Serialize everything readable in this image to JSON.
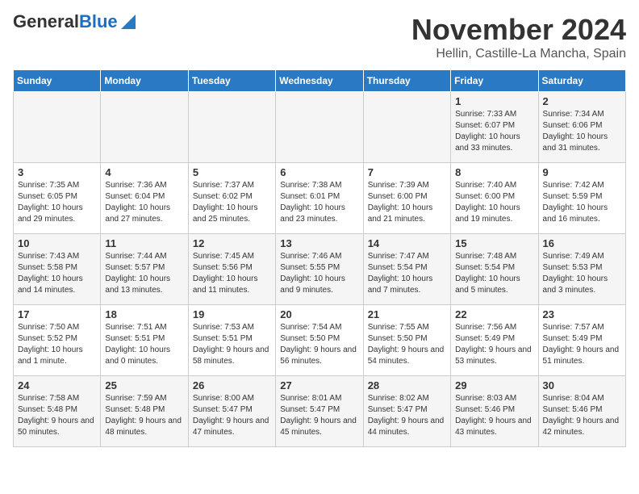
{
  "header": {
    "logo_line1": "General",
    "logo_line2": "Blue",
    "title": "November 2024",
    "subtitle": "Hellin, Castille-La Mancha, Spain"
  },
  "calendar": {
    "days_of_week": [
      "Sunday",
      "Monday",
      "Tuesday",
      "Wednesday",
      "Thursday",
      "Friday",
      "Saturday"
    ],
    "weeks": [
      [
        {
          "day": "",
          "info": ""
        },
        {
          "day": "",
          "info": ""
        },
        {
          "day": "",
          "info": ""
        },
        {
          "day": "",
          "info": ""
        },
        {
          "day": "",
          "info": ""
        },
        {
          "day": "1",
          "info": "Sunrise: 7:33 AM\nSunset: 6:07 PM\nDaylight: 10 hours and 33 minutes."
        },
        {
          "day": "2",
          "info": "Sunrise: 7:34 AM\nSunset: 6:06 PM\nDaylight: 10 hours and 31 minutes."
        }
      ],
      [
        {
          "day": "3",
          "info": "Sunrise: 7:35 AM\nSunset: 6:05 PM\nDaylight: 10 hours and 29 minutes."
        },
        {
          "day": "4",
          "info": "Sunrise: 7:36 AM\nSunset: 6:04 PM\nDaylight: 10 hours and 27 minutes."
        },
        {
          "day": "5",
          "info": "Sunrise: 7:37 AM\nSunset: 6:02 PM\nDaylight: 10 hours and 25 minutes."
        },
        {
          "day": "6",
          "info": "Sunrise: 7:38 AM\nSunset: 6:01 PM\nDaylight: 10 hours and 23 minutes."
        },
        {
          "day": "7",
          "info": "Sunrise: 7:39 AM\nSunset: 6:00 PM\nDaylight: 10 hours and 21 minutes."
        },
        {
          "day": "8",
          "info": "Sunrise: 7:40 AM\nSunset: 6:00 PM\nDaylight: 10 hours and 19 minutes."
        },
        {
          "day": "9",
          "info": "Sunrise: 7:42 AM\nSunset: 5:59 PM\nDaylight: 10 hours and 16 minutes."
        }
      ],
      [
        {
          "day": "10",
          "info": "Sunrise: 7:43 AM\nSunset: 5:58 PM\nDaylight: 10 hours and 14 minutes."
        },
        {
          "day": "11",
          "info": "Sunrise: 7:44 AM\nSunset: 5:57 PM\nDaylight: 10 hours and 13 minutes."
        },
        {
          "day": "12",
          "info": "Sunrise: 7:45 AM\nSunset: 5:56 PM\nDaylight: 10 hours and 11 minutes."
        },
        {
          "day": "13",
          "info": "Sunrise: 7:46 AM\nSunset: 5:55 PM\nDaylight: 10 hours and 9 minutes."
        },
        {
          "day": "14",
          "info": "Sunrise: 7:47 AM\nSunset: 5:54 PM\nDaylight: 10 hours and 7 minutes."
        },
        {
          "day": "15",
          "info": "Sunrise: 7:48 AM\nSunset: 5:54 PM\nDaylight: 10 hours and 5 minutes."
        },
        {
          "day": "16",
          "info": "Sunrise: 7:49 AM\nSunset: 5:53 PM\nDaylight: 10 hours and 3 minutes."
        }
      ],
      [
        {
          "day": "17",
          "info": "Sunrise: 7:50 AM\nSunset: 5:52 PM\nDaylight: 10 hours and 1 minute."
        },
        {
          "day": "18",
          "info": "Sunrise: 7:51 AM\nSunset: 5:51 PM\nDaylight: 10 hours and 0 minutes."
        },
        {
          "day": "19",
          "info": "Sunrise: 7:53 AM\nSunset: 5:51 PM\nDaylight: 9 hours and 58 minutes."
        },
        {
          "day": "20",
          "info": "Sunrise: 7:54 AM\nSunset: 5:50 PM\nDaylight: 9 hours and 56 minutes."
        },
        {
          "day": "21",
          "info": "Sunrise: 7:55 AM\nSunset: 5:50 PM\nDaylight: 9 hours and 54 minutes."
        },
        {
          "day": "22",
          "info": "Sunrise: 7:56 AM\nSunset: 5:49 PM\nDaylight: 9 hours and 53 minutes."
        },
        {
          "day": "23",
          "info": "Sunrise: 7:57 AM\nSunset: 5:49 PM\nDaylight: 9 hours and 51 minutes."
        }
      ],
      [
        {
          "day": "24",
          "info": "Sunrise: 7:58 AM\nSunset: 5:48 PM\nDaylight: 9 hours and 50 minutes."
        },
        {
          "day": "25",
          "info": "Sunrise: 7:59 AM\nSunset: 5:48 PM\nDaylight: 9 hours and 48 minutes."
        },
        {
          "day": "26",
          "info": "Sunrise: 8:00 AM\nSunset: 5:47 PM\nDaylight: 9 hours and 47 minutes."
        },
        {
          "day": "27",
          "info": "Sunrise: 8:01 AM\nSunset: 5:47 PM\nDaylight: 9 hours and 45 minutes."
        },
        {
          "day": "28",
          "info": "Sunrise: 8:02 AM\nSunset: 5:47 PM\nDaylight: 9 hours and 44 minutes."
        },
        {
          "day": "29",
          "info": "Sunrise: 8:03 AM\nSunset: 5:46 PM\nDaylight: 9 hours and 43 minutes."
        },
        {
          "day": "30",
          "info": "Sunrise: 8:04 AM\nSunset: 5:46 PM\nDaylight: 9 hours and 42 minutes."
        }
      ]
    ]
  }
}
